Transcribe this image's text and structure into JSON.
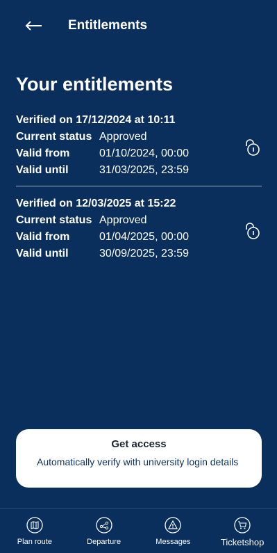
{
  "header": {
    "title": "Entitlements"
  },
  "page": {
    "title": "Your entitlements"
  },
  "entitlements": [
    {
      "heading": "Verified on 17/12/2024 at 10:11",
      "status_label": "Current status",
      "status": "Approved",
      "from_label": "Valid from",
      "from": "01/10/2024, 00:00",
      "until_label": "Valid until",
      "until": "31/03/2025, 23:59"
    },
    {
      "heading": "Verified on 12/03/2025 at 15:22",
      "status_label": "Current status",
      "status": "Approved",
      "from_label": "Valid from",
      "from": "01/04/2025, 00:00",
      "until_label": "Valid until",
      "until": "30/09/2025, 23:59"
    }
  ],
  "card": {
    "title": "Get access",
    "description": "Automatically verify with university login details"
  },
  "nav": [
    {
      "label": "Plan route",
      "icon": "map-icon"
    },
    {
      "label": "Departure",
      "icon": "route-icon"
    },
    {
      "label": "Messages",
      "icon": "warning-icon"
    },
    {
      "label": "Ticketshop",
      "icon": "cart-icon"
    }
  ],
  "colors": {
    "background": "#0a2f5c",
    "card": "#ffffff",
    "text": "#ffffff"
  }
}
